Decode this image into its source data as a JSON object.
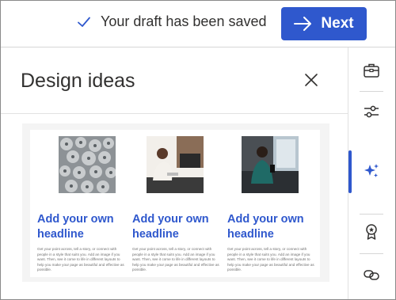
{
  "topbar": {
    "status_text": "Your draft has been saved",
    "next_label": "Next",
    "accent_color": "#2f58cd"
  },
  "pane": {
    "title": "Design ideas",
    "ideas": [
      {
        "image": "aerial-forest-trees",
        "headline": "Add your own headline",
        "body": "Get your point across, tell a story, or connect with people in a style that suits you. Add an image if you want. Then, see it come to life in different layouts to help you make your page as beautiful and effective as possible."
      },
      {
        "image": "woman-at-desk-monitor",
        "headline": "Add your own headline",
        "body": "Get your point across, tell a story, or connect with people in a style that suits you. Add an image if you want. Then, see it come to life in different layouts to help you make your page as beautiful and effective as possible."
      },
      {
        "image": "woman-on-sofa-phone",
        "headline": "Add your own headline",
        "body": "Get your point across, tell a story, or connect with people in a style that suits you. Add an image if you want. Then, see it come to life in different layouts to help you make your page as beautiful and effective as possible."
      }
    ]
  },
  "sidebar": {
    "items": [
      {
        "icon": "toolbox-icon"
      },
      {
        "icon": "sliders-icon"
      },
      {
        "icon": "sparkle-icon",
        "active": true
      },
      {
        "icon": "award-ribbon-icon"
      },
      {
        "icon": "link-icon"
      }
    ]
  }
}
